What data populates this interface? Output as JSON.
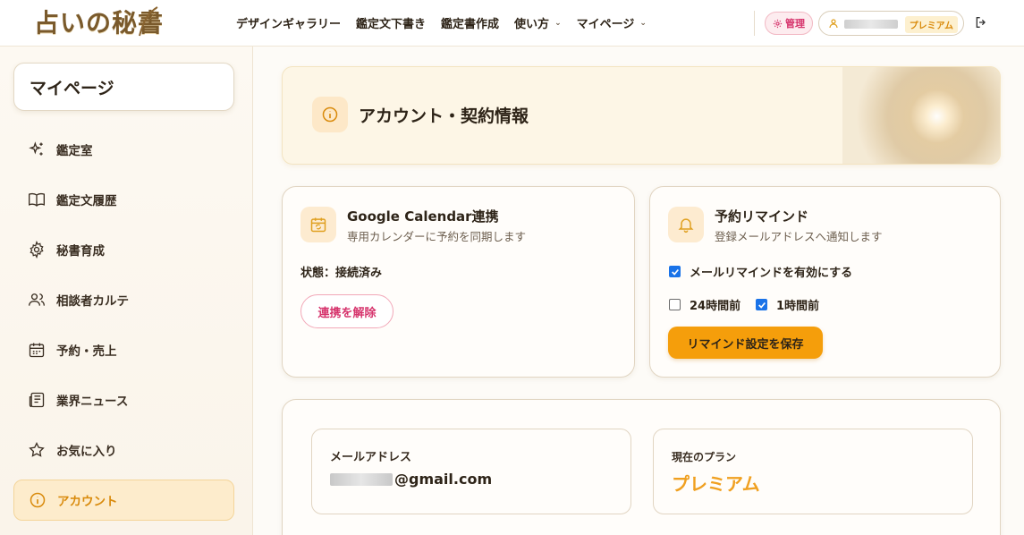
{
  "header": {
    "logo": "占いの秘書",
    "nav": [
      {
        "label": "デザインギャラリー",
        "dropdown": false
      },
      {
        "label": "鑑定文下書き",
        "dropdown": false
      },
      {
        "label": "鑑定書作成",
        "dropdown": false
      },
      {
        "label": "使い方",
        "dropdown": true
      },
      {
        "label": "マイページ",
        "dropdown": true
      }
    ],
    "admin_label": "管理",
    "user_plan_tag": "プレミアム"
  },
  "sidebar": {
    "title": "マイページ",
    "items": [
      {
        "label": "鑑定室",
        "icon": "sparkles-icon"
      },
      {
        "label": "鑑定文履歴",
        "icon": "book-icon"
      },
      {
        "label": "秘書育成",
        "icon": "gear-icon"
      },
      {
        "label": "相談者カルテ",
        "icon": "users-icon"
      },
      {
        "label": "予約・売上",
        "icon": "calendar-icon"
      },
      {
        "label": "業界ニュース",
        "icon": "newspaper-icon"
      },
      {
        "label": "お気に入り",
        "icon": "star-icon"
      },
      {
        "label": "アカウント",
        "icon": "info-icon",
        "active": true
      }
    ]
  },
  "hero": {
    "title": "アカウント・契約情報"
  },
  "gcal": {
    "title": "Google Calendar連携",
    "subtitle": "専用カレンダーに予約を同期します",
    "status": "状態：接続済み",
    "disconnect_label": "連携を解除"
  },
  "reminder": {
    "title": "予約リマインド",
    "subtitle": "登録メールアドレスへ通知します",
    "enable_label": "メールリマインドを有効にする",
    "enable_checked": true,
    "opt_24h_label": "24時間前",
    "opt_24h_checked": false,
    "opt_1h_label": "1時間前",
    "opt_1h_checked": true,
    "save_label": "リマインド設定を保存"
  },
  "account": {
    "email_label": "メールアドレス",
    "email_domain": "@gmail.com",
    "plan_label": "現在のプラン",
    "plan_value": "プレミアム"
  },
  "colors": {
    "accent": "#f59e0b",
    "danger": "#d6336c",
    "active_bg": "#fdeccc"
  }
}
